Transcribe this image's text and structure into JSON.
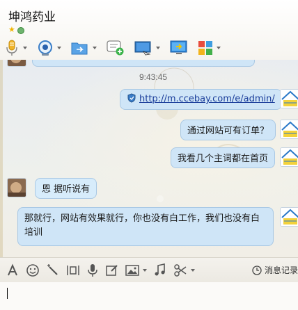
{
  "window": {
    "title": "坤鸿药业"
  },
  "header": {
    "status_icons": [
      "star-icon",
      "online-status-icon"
    ],
    "toolbar": [
      {
        "name": "voice-call-button",
        "icon": "microphone-icon",
        "has_dropdown": true
      },
      {
        "name": "video-call-button",
        "icon": "webcam-icon",
        "has_dropdown": true
      },
      {
        "name": "send-file-button",
        "icon": "folder-transfer-icon",
        "has_dropdown": true
      },
      {
        "name": "create-discussion-button",
        "icon": "chat-add-icon",
        "has_dropdown": false
      },
      {
        "name": "remote-assist-button",
        "icon": "remote-desktop-icon",
        "has_dropdown": true
      },
      {
        "name": "share-screen-button",
        "icon": "screen-share-icon",
        "has_dropdown": false
      },
      {
        "name": "apps-button",
        "icon": "apps-grid-icon",
        "has_dropdown": true
      }
    ]
  },
  "chat": {
    "timestamp": "9:43:45",
    "messages": [
      {
        "direction": "out",
        "type": "link",
        "text": "http://m.ccebay.com/e/admin/",
        "prefix_icon": "shield-icon"
      },
      {
        "direction": "out",
        "text": "通过网站可有订单？"
      },
      {
        "direction": "out",
        "text": "我看几个主词都在首页"
      },
      {
        "direction": "in",
        "text": "恩 据听说有"
      },
      {
        "direction": "out",
        "text": "那就行，网站有效果就行，你也没有白工作，我们也没有白培训"
      }
    ]
  },
  "input_toolbar": {
    "items": [
      "font-icon",
      "emoji-icon",
      "magic-wand-icon",
      "screenshot-icon",
      "voice-message-icon",
      "edit-icon",
      "image-icon",
      "music-icon",
      "scissors-icon"
    ],
    "history_label": "消息记录"
  },
  "colors": {
    "bubble": "#cfe5f7",
    "bubble_border": "#a9c8e4",
    "link": "#1a3d9a"
  }
}
